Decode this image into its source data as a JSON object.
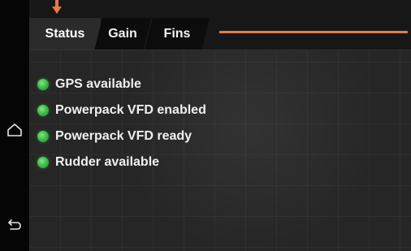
{
  "tabs": [
    {
      "label": "Status",
      "active": true
    },
    {
      "label": "Gain",
      "active": false
    },
    {
      "label": "Fins",
      "active": false
    }
  ],
  "status_items": [
    {
      "label": "GPS available",
      "state": "ok"
    },
    {
      "label": "Powerpack VFD enabled",
      "state": "ok"
    },
    {
      "label": "Powerpack VFD ready",
      "state": "ok"
    },
    {
      "label": "Rudder available",
      "state": "ok"
    }
  ],
  "icons": {
    "home": "home-icon",
    "back": "back-icon",
    "active_tab_indicator": "arrow-down-icon"
  },
  "colors": {
    "accent": "#e87a45",
    "status_ok": "#3fbf4b",
    "background": "#262626",
    "side_rail": "#050505"
  }
}
